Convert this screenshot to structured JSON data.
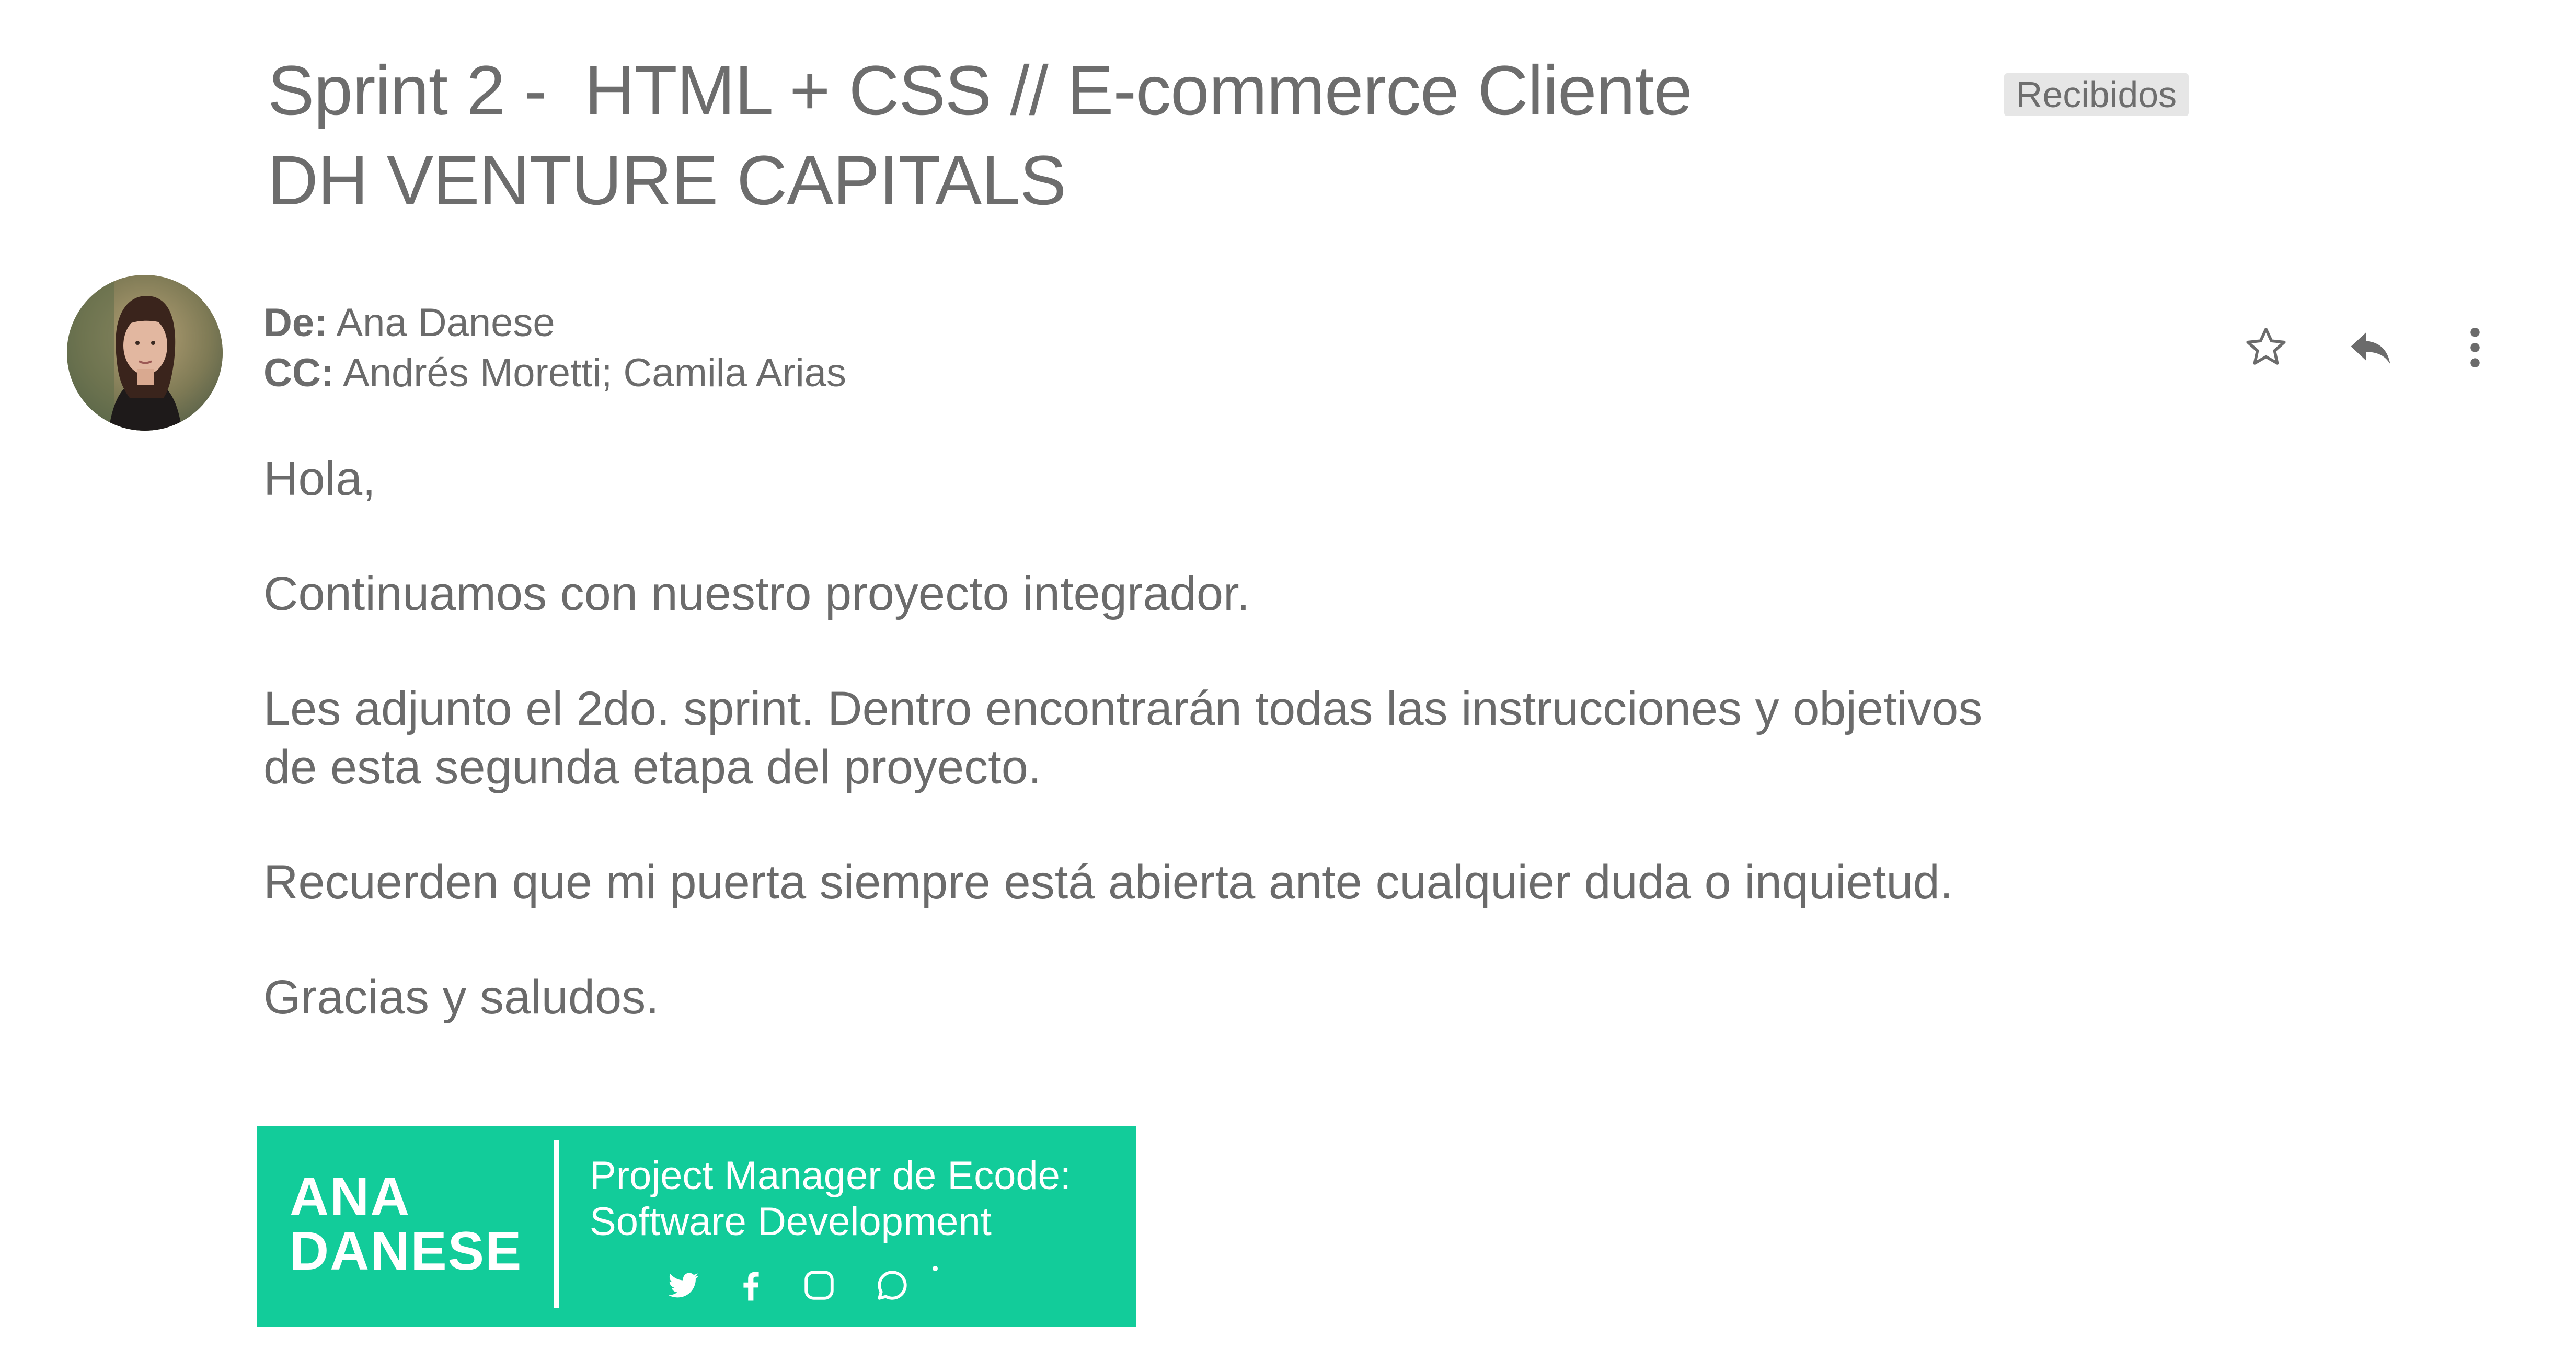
{
  "email": {
    "subject_line1": "Sprint 2 -  HTML + CSS // E-commerce Cliente",
    "subject_line2": "DH VENTURE CAPITALS",
    "label": "Recibidos",
    "from_key": "De:",
    "from_value": "Ana Danese",
    "cc_key": "CC:",
    "cc_value": "Andrés Moretti; Camila Arias",
    "actions": {
      "star_icon": "star-icon",
      "reply_icon": "reply-icon",
      "more_icon": "more-vertical-icon"
    },
    "body": [
      "Hola,",
      "Continuamos con nuestro proyecto integrador.",
      "Les adjunto el 2do. sprint. Dentro encontrarán todas las instrucciones y objetivos\nde esta segunda etapa del proyecto.",
      "Recuerden que mi puerta siempre está abierta ante cualquier duda o inquietud.",
      "Gracias y saludos."
    ]
  },
  "signature": {
    "name_line1": "ANA",
    "name_line2": "DANESE",
    "role_line1": "Project Manager de Ecode:",
    "role_line2": "Software Development",
    "background_color": "#12cc9a",
    "social_icons": [
      "twitter-icon",
      "facebook-icon",
      "instagram-icon",
      "whatsapp-icon"
    ]
  }
}
